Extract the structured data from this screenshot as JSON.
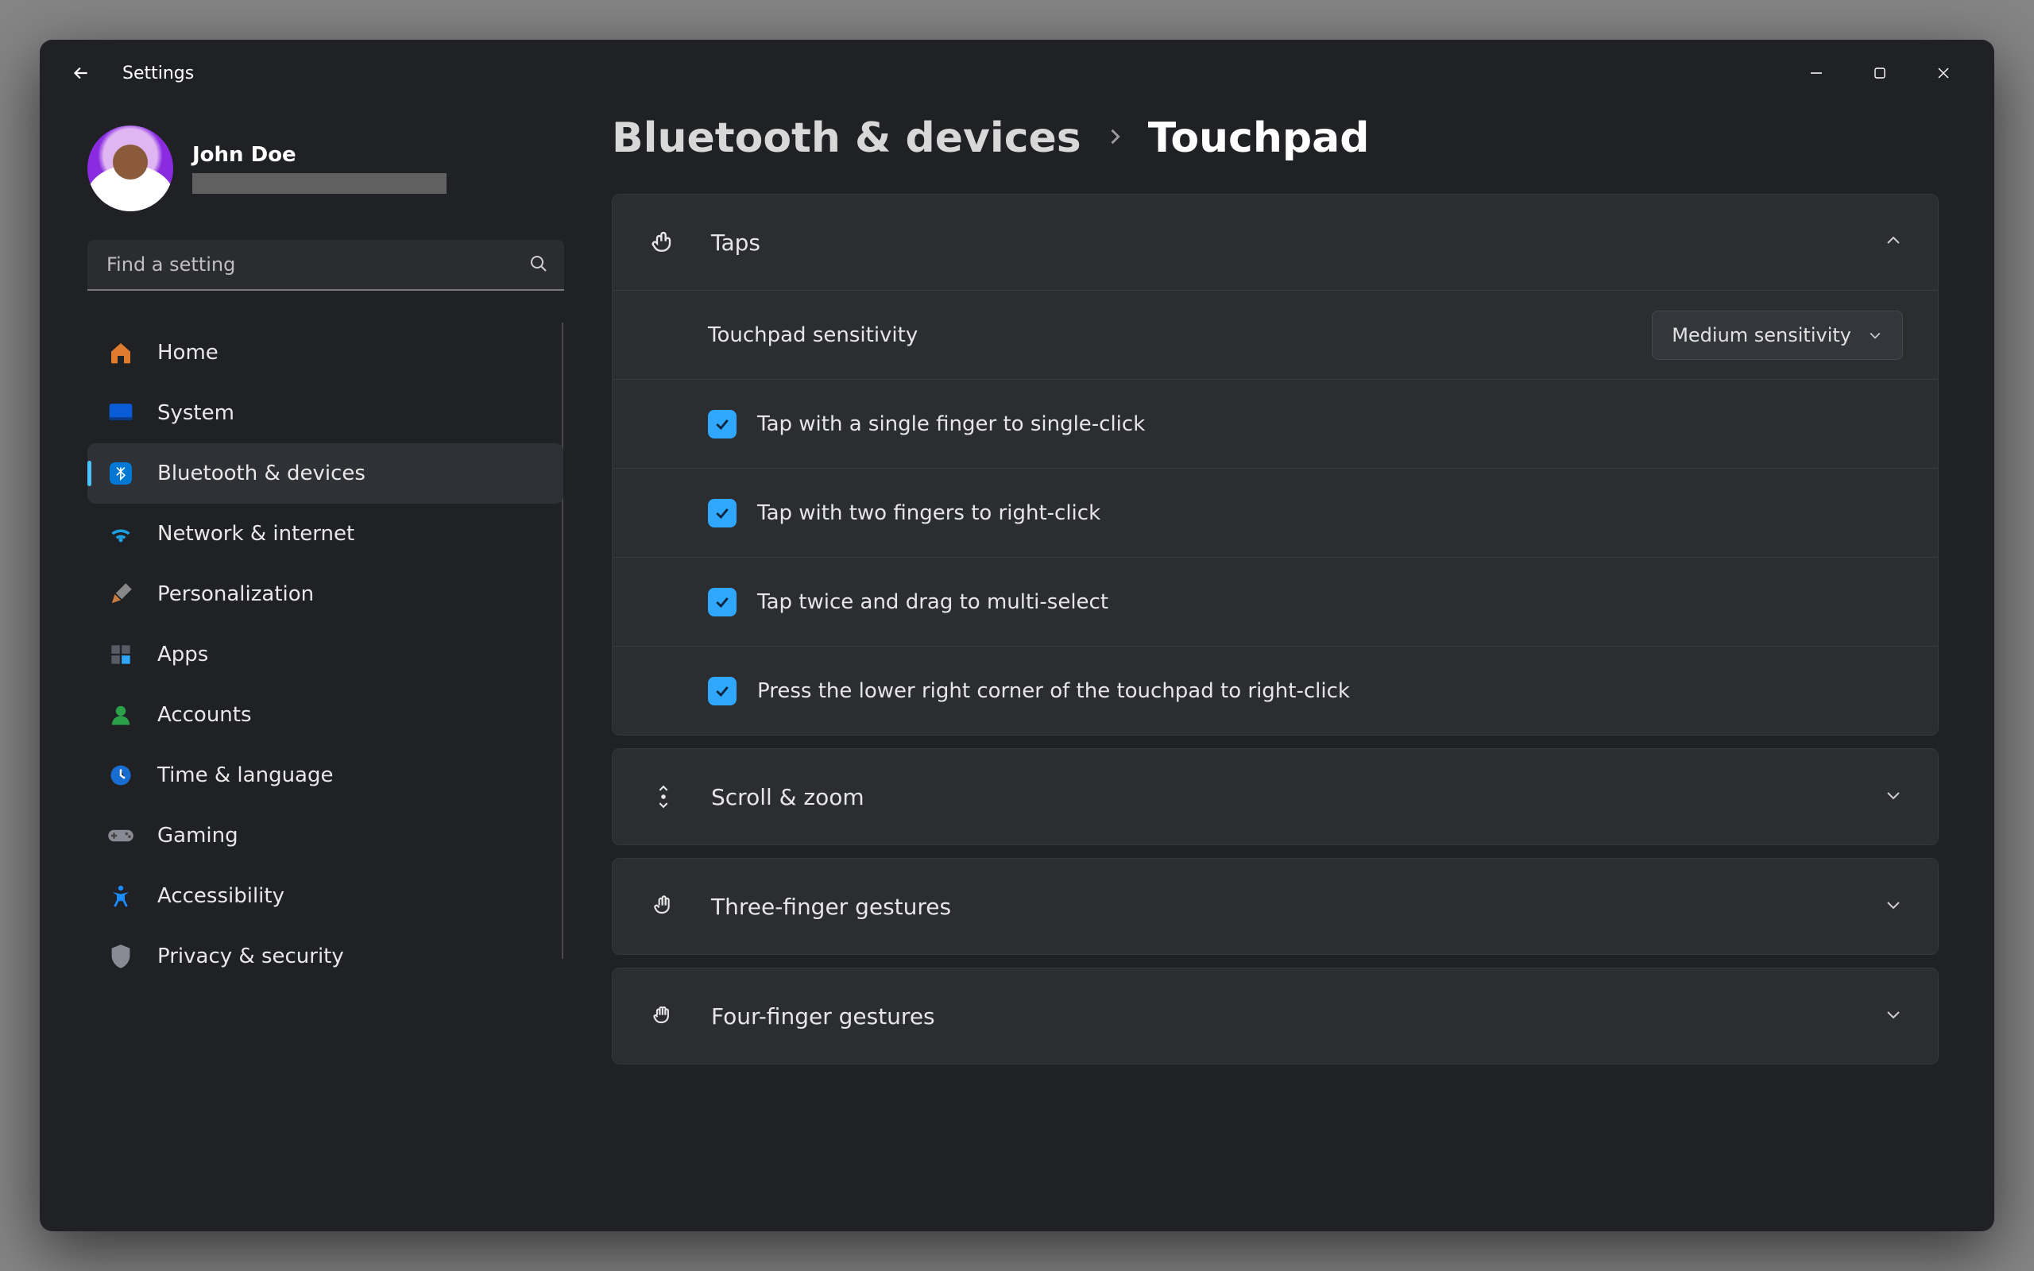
{
  "titlebar": {
    "title": "Settings"
  },
  "profile": {
    "name": "John Doe"
  },
  "search": {
    "placeholder": "Find a setting"
  },
  "nav": [
    {
      "id": "home",
      "label": "Home"
    },
    {
      "id": "system",
      "label": "System"
    },
    {
      "id": "bluetooth",
      "label": "Bluetooth & devices",
      "active": true
    },
    {
      "id": "network",
      "label": "Network & internet"
    },
    {
      "id": "personalization",
      "label": "Personalization"
    },
    {
      "id": "apps",
      "label": "Apps"
    },
    {
      "id": "accounts",
      "label": "Accounts"
    },
    {
      "id": "time",
      "label": "Time & language"
    },
    {
      "id": "gaming",
      "label": "Gaming"
    },
    {
      "id": "accessibility",
      "label": "Accessibility"
    },
    {
      "id": "privacy",
      "label": "Privacy & security"
    }
  ],
  "breadcrumb": {
    "parent": "Bluetooth & devices",
    "current": "Touchpad"
  },
  "taps": {
    "header": "Taps",
    "sensitivity_label": "Touchpad sensitivity",
    "sensitivity_value": "Medium sensitivity",
    "checks": [
      "Tap with a single finger to single-click",
      "Tap with two fingers to right-click",
      "Tap twice and drag to multi-select",
      "Press the lower right corner of the touchpad to right-click"
    ]
  },
  "sections": {
    "scroll": "Scroll & zoom",
    "three": "Three-finger gestures",
    "four": "Four-finger gestures"
  }
}
